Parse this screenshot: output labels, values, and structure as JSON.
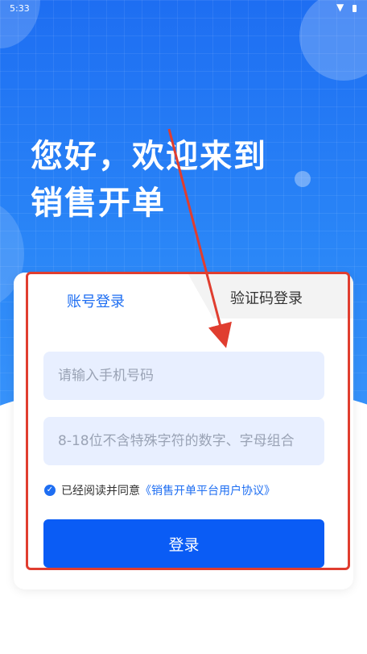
{
  "status_bar": {
    "time": "5:33"
  },
  "headline": {
    "line1": "您好，欢迎来到",
    "line2": "销售开单"
  },
  "tabs": {
    "account_label": "账号登录",
    "sms_label": "验证码登录"
  },
  "form": {
    "phone_placeholder": "请输入手机号码",
    "phone_value": "",
    "password_placeholder": "8-18位不含特殊字符的数字、字母组合",
    "password_value": ""
  },
  "agreement": {
    "prefix": "已经阅读并同意",
    "link": "《销售开单平台用户协议》",
    "checked": true
  },
  "login_button": {
    "label": "登录"
  },
  "colors": {
    "brand": "#1e6ef2",
    "button": "#0a5cf5",
    "annotation": "#e03d2f",
    "input_bg": "#e8efff"
  },
  "icons": {
    "check": "check-circle-icon",
    "wifi": "wifi-icon",
    "battery": "battery-icon"
  }
}
